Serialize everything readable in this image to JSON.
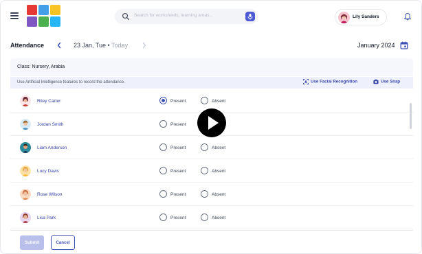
{
  "header": {
    "search_placeholder": "Search for worksheets, learning areas...",
    "user_name": "Lily Sanders"
  },
  "toolbar": {
    "title": "Attendance",
    "date": "23 Jan, Tue",
    "separator": " • ",
    "today": "Today",
    "month": "January 2024"
  },
  "class_label": "Class: Nursery, Arabia",
  "ai": {
    "message": "Use Artificial Intelligence features to record the attendance.",
    "facial": "Use Facial Recognition",
    "snap": "Use Snap"
  },
  "options": {
    "present": "Present",
    "absent": "Absent"
  },
  "students": [
    {
      "name": "Riley Carter",
      "status": "present"
    },
    {
      "name": "Jordan Smith",
      "status": "none"
    },
    {
      "name": "Liam Anderson",
      "status": "none"
    },
    {
      "name": "Lucy Davis",
      "status": "none"
    },
    {
      "name": "Rose Wilson",
      "status": "none"
    },
    {
      "name": "Lisa Park",
      "status": "none"
    }
  ],
  "footer": {
    "submit": "Submit",
    "cancel": "Cancel"
  },
  "colors": {
    "accent": "#3f51b5",
    "link": "#2f3da8",
    "submit_disabled": "#b8bfea",
    "ai_bar": "#eef0fb"
  }
}
